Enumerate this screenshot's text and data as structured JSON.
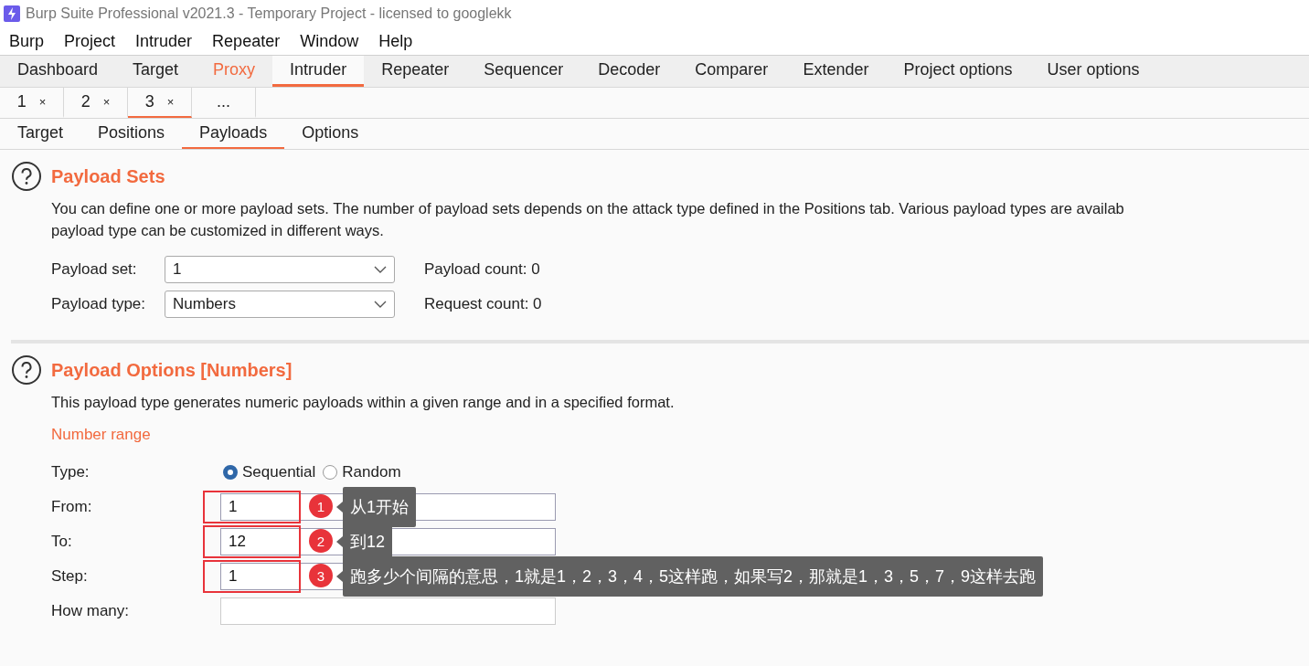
{
  "window": {
    "title": "Burp Suite Professional v2021.3 - Temporary Project - licensed to googlekk"
  },
  "menu": [
    "Burp",
    "Project",
    "Intruder",
    "Repeater",
    "Window",
    "Help"
  ],
  "main_tabs": [
    {
      "label": "Dashboard",
      "selected": false,
      "highlighted": false
    },
    {
      "label": "Target",
      "selected": false,
      "highlighted": false
    },
    {
      "label": "Proxy",
      "selected": false,
      "highlighted": true
    },
    {
      "label": "Intruder",
      "selected": true,
      "highlighted": false
    },
    {
      "label": "Repeater",
      "selected": false,
      "highlighted": false
    },
    {
      "label": "Sequencer",
      "selected": false,
      "highlighted": false
    },
    {
      "label": "Decoder",
      "selected": false,
      "highlighted": false
    },
    {
      "label": "Comparer",
      "selected": false,
      "highlighted": false
    },
    {
      "label": "Extender",
      "selected": false,
      "highlighted": false
    },
    {
      "label": "Project options",
      "selected": false,
      "highlighted": false
    },
    {
      "label": "User options",
      "selected": false,
      "highlighted": false
    }
  ],
  "instance_tabs": [
    {
      "label": "1",
      "close": "×",
      "selected": false
    },
    {
      "label": "2",
      "close": "×",
      "selected": false
    },
    {
      "label": "3",
      "close": "×",
      "selected": true
    },
    {
      "label": "...",
      "selected": false
    }
  ],
  "intruder_tabs": [
    {
      "label": "Target",
      "selected": false
    },
    {
      "label": "Positions",
      "selected": false
    },
    {
      "label": "Payloads",
      "selected": true
    },
    {
      "label": "Options",
      "selected": false
    }
  ],
  "payload_sets": {
    "title": "Payload Sets",
    "description": "You can define one or more payload sets. The number of payload sets depends on the attack type defined in the Positions tab. Various payload types are availab",
    "description_2": "payload type can be customized in different ways.",
    "fields": [
      {
        "label": "Payload set:",
        "value": "1",
        "info": "Payload count: 0"
      },
      {
        "label": "Payload type:",
        "value": "Numbers",
        "info": "Request count: 0"
      }
    ]
  },
  "payload_options": {
    "title": "Payload Options [Numbers]",
    "description": "This payload type generates numeric payloads within a given range and in a specified format.",
    "group": "Number range",
    "type": {
      "label": "Type:",
      "options": [
        {
          "label": "Sequential",
          "selected": true
        },
        {
          "label": "Random",
          "selected": false
        }
      ]
    },
    "fields": [
      {
        "label": "From:",
        "value": "1",
        "annotation": {
          "number": "1",
          "text": "从1开始"
        }
      },
      {
        "label": "To:",
        "value": "12",
        "annotation": {
          "number": "2",
          "text": "到12"
        }
      },
      {
        "label": "Step:",
        "value": "1",
        "annotation": {
          "number": "3",
          "text": "跑多少个间隔的意思，1就是1，2，3，4，5这样跑，如果写2，那就是1，3，5，7，9这样去跑"
        }
      },
      {
        "label": "How many:"
      }
    ]
  }
}
